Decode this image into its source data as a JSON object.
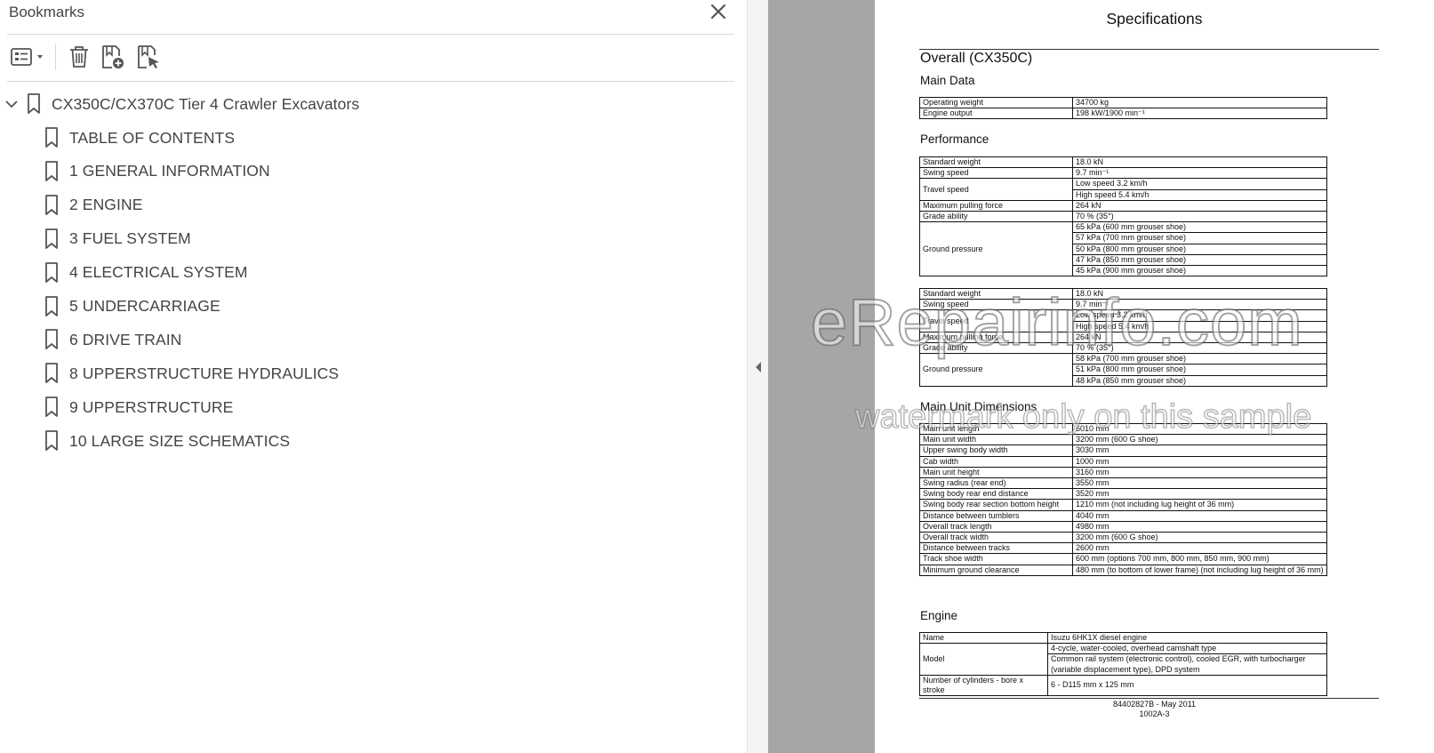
{
  "bookmarks_panel": {
    "title": "Bookmarks",
    "root": {
      "label": "CX350C/CX370C Tier 4 Crawler Excavators",
      "expanded": true
    },
    "items": [
      {
        "label": "TABLE OF CONTENTS"
      },
      {
        "label": "1 GENERAL INFORMATION"
      },
      {
        "label": "2 ENGINE"
      },
      {
        "label": "3 FUEL SYSTEM"
      },
      {
        "label": "4 ELECTRICAL SYSTEM"
      },
      {
        "label": "5 UNDERCARRIAGE"
      },
      {
        "label": "6 DRIVE TRAIN"
      },
      {
        "label": "8 UPPERSTRUCTURE HYDRAULICS"
      },
      {
        "label": "9 UPPERSTRUCTURE"
      },
      {
        "label": "10 LARGE SIZE SCHEMATICS"
      }
    ],
    "toolbar": [
      "options-menu-icon",
      "delete-icon",
      "add-bookmark-icon",
      "find-bookmark-icon"
    ]
  },
  "document": {
    "page_title": "Specifications",
    "overall_heading": "Overall (CX350C)",
    "main_data_heading": "Main Data",
    "main_data": [
      [
        "Operating weight",
        "34700 kg"
      ],
      [
        "Engine output",
        "198 kW/1900 min⁻¹"
      ]
    ],
    "performance_heading": "Performance",
    "performance_1": [
      [
        "Standard weight",
        [
          "18.0 kN"
        ]
      ],
      [
        "Swing speed",
        [
          "9.7 min⁻¹"
        ]
      ],
      [
        "Travel speed",
        [
          "Low speed 3.2 km/h",
          "High speed 5.4 km/h"
        ]
      ],
      [
        "Maximum pulling force",
        [
          "264 kN"
        ]
      ],
      [
        "Grade ability",
        [
          "70 % (35°)"
        ]
      ],
      [
        "Ground pressure",
        [
          "65 kPa (600 mm grouser shoe)",
          "57 kPa (700 mm grouser shoe)",
          "50 kPa (800 mm grouser shoe)",
          "47 kPa (850 mm grouser shoe)",
          "45 kPa (900 mm grouser shoe)"
        ]
      ]
    ],
    "performance_2": [
      [
        "Standard weight",
        [
          "18.0 kN"
        ]
      ],
      [
        "Swing speed",
        [
          "9.7 min⁻¹"
        ]
      ],
      [
        "Travel speed",
        [
          "Low speed 3.2 km/h",
          "High speed 5.4 km/h"
        ]
      ],
      [
        "Maximum pulling force",
        [
          "264 kN"
        ]
      ],
      [
        "Grade ability",
        [
          "70 % (35°)"
        ]
      ],
      [
        "Ground pressure",
        [
          "58 kPa (700 mm grouser shoe)",
          "51 kPa (800 mm grouser shoe)",
          "48 kPa (850 mm grouser shoe)"
        ]
      ]
    ],
    "dimensions_heading": "Main Unit Dimensions",
    "dimensions": [
      [
        "Main unit length",
        [
          "6010 mm"
        ]
      ],
      [
        "Main unit width",
        [
          "3200 mm (600 G shoe)"
        ]
      ],
      [
        "Upper swing body width",
        [
          "3030 mm"
        ]
      ],
      [
        "Cab width",
        [
          "1000 mm"
        ]
      ],
      [
        "Main unit height",
        [
          "3160 mm"
        ]
      ],
      [
        "Swing radius (rear end)",
        [
          "3550 mm"
        ]
      ],
      [
        "Swing body rear end distance",
        [
          "3520 mm"
        ]
      ],
      [
        "Swing body rear section bottom height",
        [
          "1210 mm (not including lug height of 36 mm)"
        ]
      ],
      [
        "Distance between tumblers",
        [
          "4040 mm"
        ]
      ],
      [
        "Overall track length",
        [
          "4980 mm"
        ]
      ],
      [
        "Overall track width",
        [
          "3200 mm (600 G shoe)"
        ]
      ],
      [
        "Distance between tracks",
        [
          "2600 mm"
        ]
      ],
      [
        "Track shoe width",
        [
          "600 mm (options 700 mm, 800 mm, 850 mm, 900 mm)"
        ]
      ],
      [
        "Minimum ground clearance",
        [
          "480 mm (to bottom of lower frame) (not including lug height of 36 mm)"
        ]
      ]
    ],
    "engine_heading": "Engine",
    "engine": [
      [
        "Name",
        [
          "Isuzu 6HK1X diesel engine"
        ]
      ],
      [
        "Model",
        [
          "4-cycle, water-cooled, overhead camshaft type",
          "Common rail system (electronic control), cooled EGR, with turbocharger (variable displacement type), DPD system"
        ]
      ],
      [
        "Number of cylinders - bore x stroke",
        [
          "6 - D115 mm x 125 mm"
        ]
      ]
    ],
    "footer_doc": "84402827B - May 2011",
    "footer_page": "1002A-3"
  },
  "watermark": {
    "line1": "eRepairinfo.com",
    "line2": "watermark only on this sample"
  }
}
